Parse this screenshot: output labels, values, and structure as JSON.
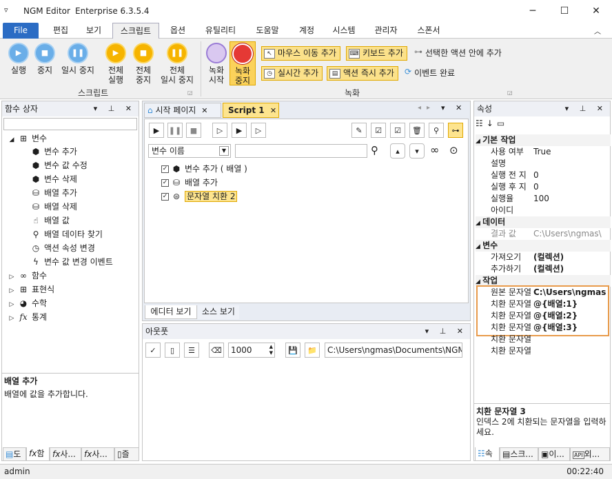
{
  "app": {
    "name": "NGM Editor",
    "edition": "Enterprise 6.3.5.4"
  },
  "menu": {
    "file": "File",
    "tabs": [
      "편집",
      "보기",
      "스크립트",
      "옵션",
      "유틸리티",
      "도움말",
      "계정",
      "시스템",
      "관리자",
      "스폰서"
    ],
    "active": "스크립트"
  },
  "ribbon": {
    "script_group": {
      "label": "스크립트",
      "run": "실행",
      "stop": "중지",
      "pause": "일시 중지",
      "run_all_1": "전체",
      "run_all_2": "실행",
      "stop_all_1": "전체",
      "stop_all_2": "중지",
      "pause_all_1": "전체",
      "pause_all_2": "일시 중지"
    },
    "record_group": {
      "label": "녹화",
      "rec_start_1": "녹화",
      "rec_start_2": "시작",
      "rec_stop_1": "녹화",
      "rec_stop_2": "중지",
      "mouse_move": "마우스 이동 추가",
      "keyboard": "키보드 추가",
      "in_selected": "선택한 액션 안에 추가",
      "realtime": "실시간 추가",
      "instant": "액션 즉시 추가",
      "event_done": "이벤트 완료"
    }
  },
  "left_panel": {
    "title": "함수 상자",
    "tree": {
      "variables": "변수",
      "var_items": [
        "변수 추가",
        "변수 값 수정",
        "변수 삭제",
        "배열 추가",
        "배열 삭제",
        "배열 값",
        "배열 데이타 찾기",
        "액션 속성 변경",
        "변수 값 변경 이벤트"
      ],
      "function": "함수",
      "expression": "표현식",
      "math": "수학",
      "stats": "통계"
    },
    "desc_title": "배열 추가",
    "desc_text": "배열에 값을 추가합니다.",
    "bottom_tabs": [
      "도",
      "함",
      "사...",
      "사...",
      "즐"
    ]
  },
  "editor": {
    "tabs": [
      "시작 페이지",
      "Script 1"
    ],
    "filter_select": "변수 이름",
    "filter_text": "",
    "actions": [
      "변수 추가 ( 배열 )",
      "배열 추가",
      "문자열 치환 2"
    ],
    "view_tabs": [
      "에디터 보기",
      "소스 보기"
    ]
  },
  "output": {
    "title": "아웃풋",
    "limit": "1000",
    "path": "C:\\Users\\ngmas\\Documents\\NGM6\\"
  },
  "props": {
    "title": "속성",
    "cat_basic": "기본 작업",
    "basic": [
      {
        "k": "사용 여부",
        "v": "True"
      },
      {
        "k": "설명",
        "v": ""
      },
      {
        "k": "실행 전 지",
        "v": "0"
      },
      {
        "k": "실행 후 지",
        "v": "0"
      },
      {
        "k": "실행율",
        "v": "100"
      },
      {
        "k": "아이디",
        "v": ""
      }
    ],
    "cat_data": "데이터",
    "data": [
      {
        "k": "결과 값",
        "v": "C:\\Users\\ngmas\\"
      }
    ],
    "cat_var": "변수",
    "var": [
      {
        "k": "가져오기",
        "v": "(컬렉션)"
      },
      {
        "k": "추가하기",
        "v": "(컬렉션)"
      }
    ],
    "cat_job": "작업",
    "job": [
      {
        "k": "원본 문자열",
        "v": "C:\\Users\\ngmas"
      },
      {
        "k": "치환 문자열",
        "v": "@{배열:1}"
      },
      {
        "k": "치환 문자열",
        "v": "@{배열:2}"
      },
      {
        "k": "치환 문자열",
        "v": "@{배열:3}"
      },
      {
        "k": "치환 문자열",
        "v": ""
      },
      {
        "k": "치환 문자열",
        "v": ""
      }
    ],
    "desc_title": "치환 문자열 3",
    "desc_text": "인덱스 2에 치환되는 문자열을 입력하세요.",
    "bottom_tabs": [
      "속",
      "스크...",
      "이...",
      "외..."
    ]
  },
  "status": {
    "user": "admin",
    "time": "00:22:40"
  }
}
